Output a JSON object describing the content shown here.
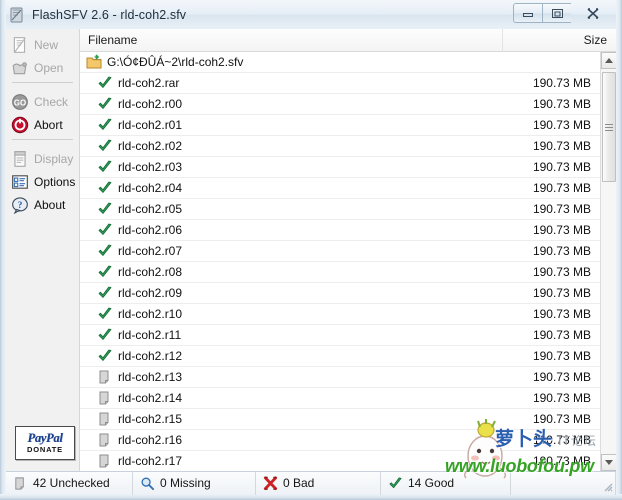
{
  "window": {
    "title": "FlashSFV 2.6 - rld-coh2.sfv",
    "icon": "app-icon",
    "buttons": {
      "minimize": "minimize-icon",
      "restore": "restore-icon",
      "close": "close-icon"
    }
  },
  "sidebar": {
    "groups": [
      {
        "items": [
          {
            "label": "New",
            "icon": "new-icon",
            "enabled": false
          },
          {
            "label": "Open",
            "icon": "open-icon",
            "enabled": false
          }
        ]
      },
      {
        "items": [
          {
            "label": "Check",
            "icon": "check-go-icon",
            "enabled": false
          },
          {
            "label": "Abort",
            "icon": "abort-icon",
            "enabled": true
          }
        ]
      },
      {
        "items": [
          {
            "label": "Display",
            "icon": "display-icon",
            "enabled": false
          },
          {
            "label": "Options",
            "icon": "options-icon",
            "enabled": true
          },
          {
            "label": "About",
            "icon": "about-icon",
            "enabled": true
          }
        ]
      }
    ],
    "donate": {
      "brand": "PayPal",
      "sub": "DONATE"
    }
  },
  "list": {
    "columns": {
      "name": "Filename",
      "size": "Size"
    },
    "rows": [
      {
        "type": "folder",
        "icon": "folder-sfv-icon",
        "name": "G:\\Ó¢ÐÛÁ~2\\rld-coh2.sfv",
        "size": ""
      },
      {
        "type": "file",
        "icon": "good-check-icon",
        "name": "rld-coh2.rar",
        "size": "190.73 MB"
      },
      {
        "type": "file",
        "icon": "good-check-icon",
        "name": "rld-coh2.r00",
        "size": "190.73 MB"
      },
      {
        "type": "file",
        "icon": "good-check-icon",
        "name": "rld-coh2.r01",
        "size": "190.73 MB"
      },
      {
        "type": "file",
        "icon": "good-check-icon",
        "name": "rld-coh2.r02",
        "size": "190.73 MB"
      },
      {
        "type": "file",
        "icon": "good-check-icon",
        "name": "rld-coh2.r03",
        "size": "190.73 MB"
      },
      {
        "type": "file",
        "icon": "good-check-icon",
        "name": "rld-coh2.r04",
        "size": "190.73 MB"
      },
      {
        "type": "file",
        "icon": "good-check-icon",
        "name": "rld-coh2.r05",
        "size": "190.73 MB"
      },
      {
        "type": "file",
        "icon": "good-check-icon",
        "name": "rld-coh2.r06",
        "size": "190.73 MB"
      },
      {
        "type": "file",
        "icon": "good-check-icon",
        "name": "rld-coh2.r07",
        "size": "190.73 MB"
      },
      {
        "type": "file",
        "icon": "good-check-icon",
        "name": "rld-coh2.r08",
        "size": "190.73 MB"
      },
      {
        "type": "file",
        "icon": "good-check-icon",
        "name": "rld-coh2.r09",
        "size": "190.73 MB"
      },
      {
        "type": "file",
        "icon": "good-check-icon",
        "name": "rld-coh2.r10",
        "size": "190.73 MB"
      },
      {
        "type": "file",
        "icon": "good-check-icon",
        "name": "rld-coh2.r11",
        "size": "190.73 MB"
      },
      {
        "type": "file",
        "icon": "good-check-icon",
        "name": "rld-coh2.r12",
        "size": "190.73 MB"
      },
      {
        "type": "file",
        "icon": "unchecked-file-icon",
        "name": "rld-coh2.r13",
        "size": "190.73 MB"
      },
      {
        "type": "file",
        "icon": "unchecked-file-icon",
        "name": "rld-coh2.r14",
        "size": "190.73 MB"
      },
      {
        "type": "file",
        "icon": "unchecked-file-icon",
        "name": "rld-coh2.r15",
        "size": "190.73 MB"
      },
      {
        "type": "file",
        "icon": "unchecked-file-icon",
        "name": "rld-coh2.r16",
        "size": "190.73 MB"
      },
      {
        "type": "file",
        "icon": "unchecked-file-icon",
        "name": "rld-coh2.r17",
        "size": "190.73 MB"
      }
    ]
  },
  "scrollbar": {
    "up": "scroll-up-icon",
    "down": "scroll-down-icon"
  },
  "status": [
    {
      "icon": "unchecked-file-icon",
      "label": "42 Unchecked"
    },
    {
      "icon": "missing-magnifier-icon",
      "label": "0 Missing"
    },
    {
      "icon": "bad-x-icon",
      "label": "0 Bad"
    },
    {
      "icon": "good-check-icon",
      "label": "14 Good"
    },
    {
      "icon": "",
      "label": ""
    }
  ],
  "watermark": {
    "url": "www.luobofou.pw",
    "cn": "萝卜头",
    "cn_sub": "IT论坛"
  },
  "colors": {
    "good": "#2e9e52",
    "bad": "#cc2222",
    "abort": "#c8102e",
    "accent": "#35a425",
    "titlebar": "#e6eef6"
  }
}
